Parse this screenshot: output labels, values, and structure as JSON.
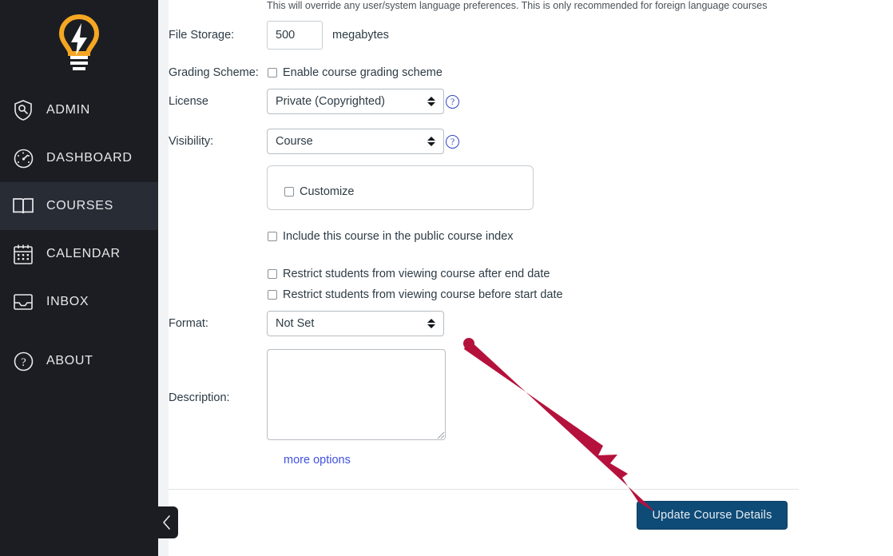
{
  "sidebar": {
    "logo": {
      "icon": "lightbulb-logo",
      "accent_color": "#f5a623"
    },
    "items": [
      {
        "label": "ADMIN",
        "icon": "shield-wrench-icon",
        "active": false
      },
      {
        "label": "DASHBOARD",
        "icon": "speedometer-icon",
        "active": false
      },
      {
        "label": "COURSES",
        "icon": "open-book-icon",
        "active": true
      },
      {
        "label": "CALENDAR",
        "icon": "calendar-icon",
        "active": false
      },
      {
        "label": "INBOX",
        "icon": "inbox-tray-icon",
        "active": false
      },
      {
        "label": "ABOUT",
        "icon": "question-circle-icon",
        "active": false
      }
    ],
    "collapse_button": {
      "icon": "chevron-left-icon",
      "glyph": "‹"
    },
    "background_color": "#1b1d22",
    "active_background_color": "#282c35"
  },
  "form": {
    "language_helper_text": "This will override any user/system language preferences. This is only recommended for foreign language courses",
    "file_storage": {
      "label": "File Storage:",
      "value": "500",
      "placeholder": "",
      "unit": "megabytes"
    },
    "grading_scheme": {
      "label": "Grading Scheme:",
      "checkbox_label": "Enable course grading scheme",
      "checked": false
    },
    "license": {
      "label": "License",
      "value": "Private (Copyrighted)",
      "help_glyph": "?",
      "options": [
        "Private (Copyrighted)"
      ]
    },
    "visibility": {
      "label": "Visibility:",
      "value": "Course",
      "help_glyph": "?",
      "options": [
        "Course"
      ]
    },
    "customize": {
      "checkbox_label": "Customize",
      "checked": false
    },
    "public_index": {
      "checkbox_label": "Include this course in the public course index",
      "checked": false
    },
    "restrict_after": {
      "checkbox_label": "Restrict students from viewing course after end date",
      "checked": false
    },
    "restrict_before": {
      "checkbox_label": "Restrict students from viewing course before start date",
      "checked": false
    },
    "format": {
      "label": "Format:",
      "value": "Not Set",
      "options": [
        "Not Set"
      ]
    },
    "description": {
      "label": "Description:",
      "value": "",
      "placeholder": ""
    },
    "more_options_link": "more options",
    "submit_button": {
      "label": "Update Course Details",
      "background_color": "#0f4b77",
      "text_color": "#e8eef2"
    }
  },
  "annotation": {
    "arrow_color": "#b4123c",
    "description": "red arrow pointing to Update Course Details button"
  }
}
